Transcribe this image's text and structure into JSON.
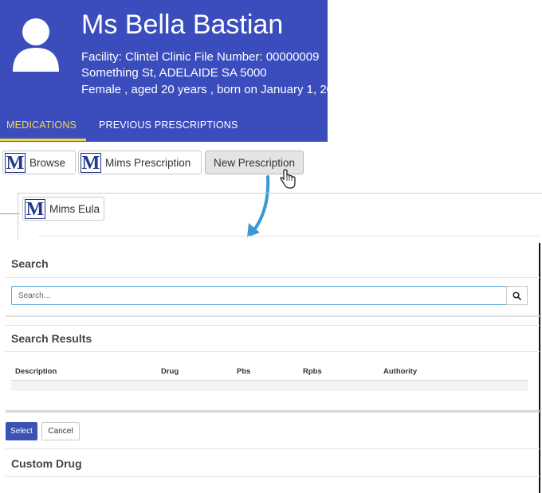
{
  "patient": {
    "name": "Ms Bella Bastian",
    "facility_line": "Facility: Clintel Clinic   File Number: 00000009",
    "address_line": "Something St, ADELAIDE SA 5000",
    "details_line": "Female , aged 20 years , born on January 1, 20"
  },
  "tabs": [
    {
      "label": "MEDICATIONS",
      "active": true
    },
    {
      "label": "PREVIOUS PRESCRIPTIONS",
      "active": false
    }
  ],
  "toolbar": {
    "browse_label": "Browse",
    "mims_prescription_label": "Mims Prescription",
    "new_prescription_label": "New Prescription",
    "mims_eula_label": "Mims Eula",
    "logo_letter": "M"
  },
  "search": {
    "title": "Search",
    "placeholder": "Search..."
  },
  "results": {
    "title": "Search Results",
    "columns": [
      "Description",
      "Drug",
      "Pbs",
      "Rpbs",
      "Authority"
    ]
  },
  "actions": {
    "select_label": "Select",
    "cancel_label": "Cancel"
  },
  "custom_drug": {
    "title": "Custom Drug"
  },
  "colors": {
    "header_bg": "#3b4dbd",
    "active_tab": "#f5d84a",
    "select_button": "#3b52b3",
    "arrow": "#3d97d3"
  }
}
